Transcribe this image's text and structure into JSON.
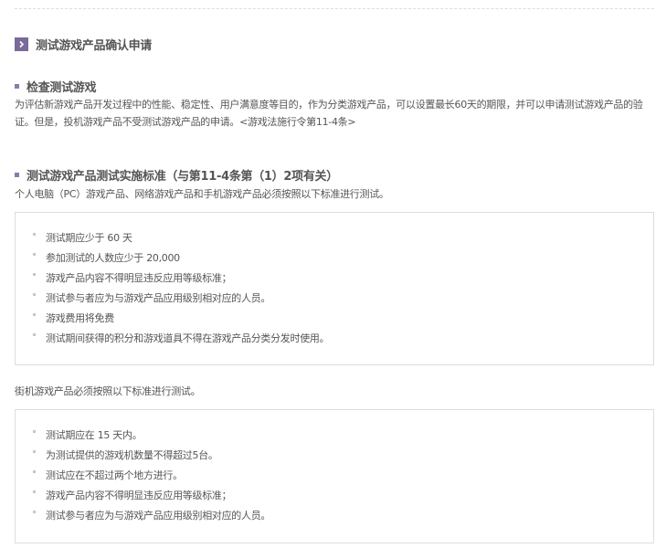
{
  "page_title": "测试游戏产品确认申请",
  "sections": [
    {
      "heading": "检查测试游戏",
      "paragraph": "为评估新游戏产品开发过程中的性能、稳定性、用户满意度等目的，作为分类游戏产品，可以设置最长60天的期限，并可以申请测试游戏产品的验证。但是，投机游戏产品不受测试游戏产品的申请。<游戏法施行令第11-4条>"
    },
    {
      "heading": "测试游戏产品测试实施标准（与第11-4条第（1）2项有关）",
      "intro": "个人电脑（PC）游戏产品、网络游戏产品和手机游戏产品必须按照以下标准进行测试。",
      "pc_items": [
        "测试期应少于 60 天",
        "参加测试的人数应少于 20,000",
        "游戏产品内容不得明显违反应用等级标准；",
        "测试参与者应为与游戏产品应用级别相对应的人员。",
        "游戏费用将免费",
        "测试期间获得的积分和游戏道具不得在游戏产品分类分发时使用。"
      ],
      "arcade_intro": "街机游戏产品必须按照以下标准进行测试。",
      "arcade_items": [
        "测试期应在 15 天内。",
        "为测试提供的游戏机数量不得超过5台。",
        "测试应在不超过两个地方进行。",
        "游戏产品内容不得明显违反应用等级标准；",
        "测试参与者应为与游戏产品应用级别相对应的人员。"
      ]
    }
  ],
  "icons": {
    "heading_icon": "chevron-right-icon",
    "subheading_icon": "square-bullet-icon",
    "list_icon": "circle-bullet-icon"
  },
  "colors": {
    "accent": "#7a6a9a",
    "bullet": "#8a7ab0",
    "text": "#555555",
    "border": "#dddddd"
  }
}
